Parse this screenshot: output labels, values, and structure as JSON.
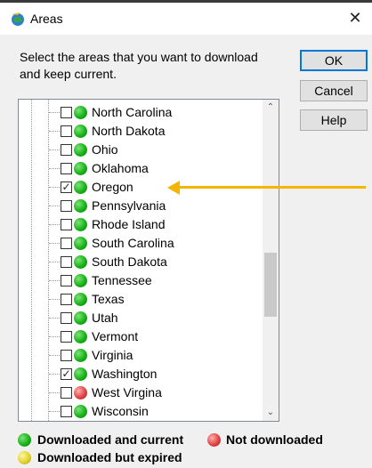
{
  "window": {
    "title": "Areas",
    "close_glyph": "✕"
  },
  "instructions": "Select the areas that you want to download and keep current.",
  "buttons": {
    "ok": "OK",
    "cancel": "Cancel",
    "help": "Help"
  },
  "areas": [
    {
      "name": "North Carolina",
      "checked": false,
      "status": "downloaded"
    },
    {
      "name": "North Dakota",
      "checked": false,
      "status": "downloaded"
    },
    {
      "name": "Ohio",
      "checked": false,
      "status": "downloaded"
    },
    {
      "name": "Oklahoma",
      "checked": false,
      "status": "downloaded"
    },
    {
      "name": "Oregon",
      "checked": true,
      "status": "downloaded"
    },
    {
      "name": "Pennsylvania",
      "checked": false,
      "status": "downloaded"
    },
    {
      "name": "Rhode Island",
      "checked": false,
      "status": "downloaded"
    },
    {
      "name": "South Carolina",
      "checked": false,
      "status": "downloaded"
    },
    {
      "name": "South Dakota",
      "checked": false,
      "status": "downloaded"
    },
    {
      "name": "Tennessee",
      "checked": false,
      "status": "downloaded"
    },
    {
      "name": "Texas",
      "checked": false,
      "status": "downloaded"
    },
    {
      "name": "Utah",
      "checked": false,
      "status": "downloaded"
    },
    {
      "name": "Vermont",
      "checked": false,
      "status": "downloaded"
    },
    {
      "name": "Virginia",
      "checked": false,
      "status": "downloaded"
    },
    {
      "name": "Washington",
      "checked": true,
      "status": "downloaded"
    },
    {
      "name": "West Virgina",
      "checked": false,
      "status": "not_downloaded"
    },
    {
      "name": "Wisconsin",
      "checked": false,
      "status": "downloaded"
    }
  ],
  "scrollbar": {
    "up_glyph": "⌃",
    "down_glyph": "⌄"
  },
  "legend": {
    "downloaded_current": "Downloaded and current",
    "not_downloaded": "Not downloaded",
    "downloaded_expired": "Downloaded but expired"
  },
  "colors": {
    "arrow": "#f5b400",
    "downloaded": "#18b318",
    "not_downloaded": "#e04545",
    "expired": "#e0d230"
  }
}
